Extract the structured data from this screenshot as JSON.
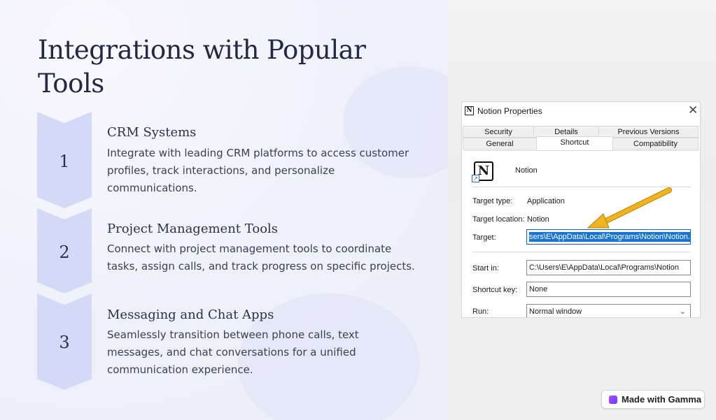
{
  "slide": {
    "title": "Integrations with Popular Tools",
    "steps": [
      {
        "number": "1",
        "title": "CRM Systems",
        "description": "Integrate with leading CRM platforms to access customer profiles, track interactions, and personalize communications."
      },
      {
        "number": "2",
        "title": "Project Management Tools",
        "description": "Connect with project management tools to coordinate tasks, assign calls, and track progress on specific projects."
      },
      {
        "number": "3",
        "title": "Messaging and Chat Apps",
        "description": "Seamlessly transition between phone calls, text messages, and chat conversations for a unified communication experience."
      }
    ]
  },
  "dialog": {
    "title": "Notion Properties",
    "close_glyph": "✕",
    "tabs_row1": [
      "Security",
      "Details",
      "Previous Versions"
    ],
    "tabs_row2": [
      "General",
      "Shortcut",
      "Compatibility"
    ],
    "active_tab": "Shortcut",
    "app_name": "Notion",
    "icon_letter": "N",
    "target_type_label": "Target type:",
    "target_type_value": "Application",
    "target_location_label": "Target location:",
    "target_location_value": "Notion",
    "target_label": "Target:",
    "target_value": "sers\\E\\AppData\\Local\\Programs\\Notion\\Notion.exe",
    "start_in_label": "Start in:",
    "start_in_value": "C:\\Users\\E\\AppData\\Local\\Programs\\Notion",
    "shortcut_key_label": "Shortcut key:",
    "shortcut_key_value": "None",
    "run_label": "Run:",
    "run_value": "Normal window",
    "arrow_color": "#f2b320"
  },
  "badge": {
    "label": "Made with Gamma"
  },
  "colors": {
    "chevron": "#d4daf6",
    "title_text": "#232945",
    "selection": "#1a73d6"
  }
}
